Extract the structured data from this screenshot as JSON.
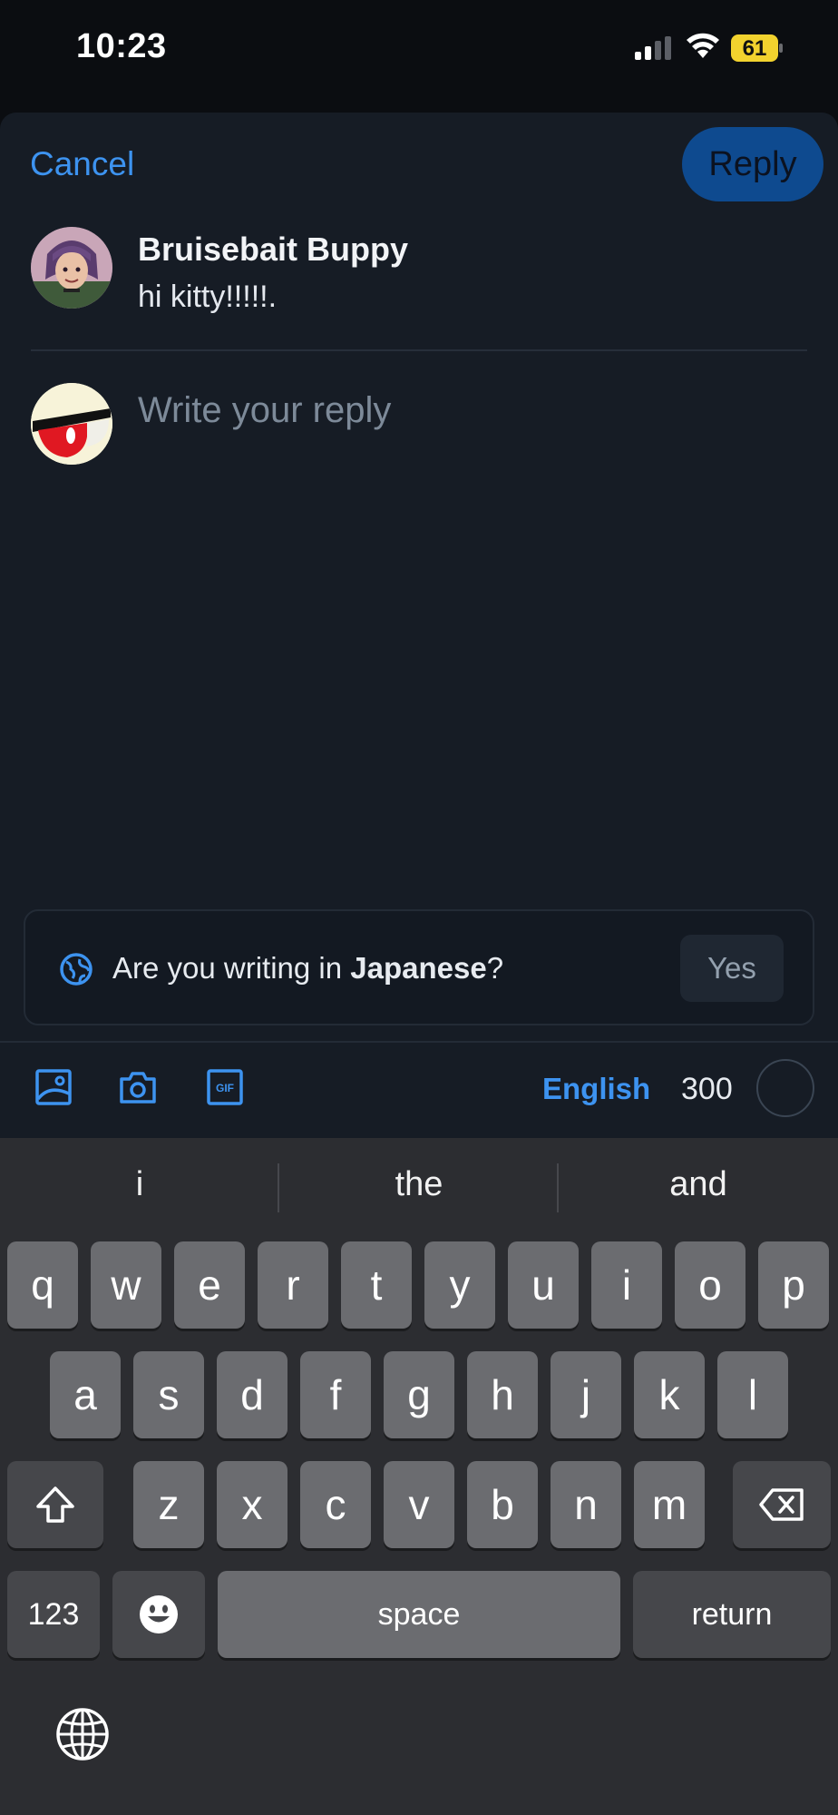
{
  "status_bar": {
    "time": "10:23",
    "battery": "61",
    "battery_color": "#f2d22e"
  },
  "header": {
    "cancel_label": "Cancel",
    "reply_label": "Reply"
  },
  "parent_post": {
    "author": "Bruisebait Buppy",
    "text": "hi kitty!!!!!."
  },
  "composer": {
    "placeholder": "Write your reply"
  },
  "language_prompt": {
    "prefix": "Are you writing in ",
    "language": "Japanese",
    "suffix": "?",
    "yes_label": "Yes"
  },
  "toolbar": {
    "icons": [
      "image-icon",
      "camera-icon",
      "gif-icon"
    ],
    "language_label": "English",
    "char_count": "300"
  },
  "keyboard": {
    "suggestions": [
      "i",
      "the",
      "and"
    ],
    "row1": [
      "q",
      "w",
      "e",
      "r",
      "t",
      "y",
      "u",
      "i",
      "o",
      "p"
    ],
    "row2": [
      "a",
      "s",
      "d",
      "f",
      "g",
      "h",
      "j",
      "k",
      "l"
    ],
    "row3": [
      "z",
      "x",
      "c",
      "v",
      "b",
      "n",
      "m"
    ],
    "numbers_label": "123",
    "space_label": "space",
    "return_label": "return"
  },
  "colors": {
    "accent": "#3d93f0",
    "sheet_bg": "#161c25",
    "reply_button_bg": "#0e4a8f"
  }
}
